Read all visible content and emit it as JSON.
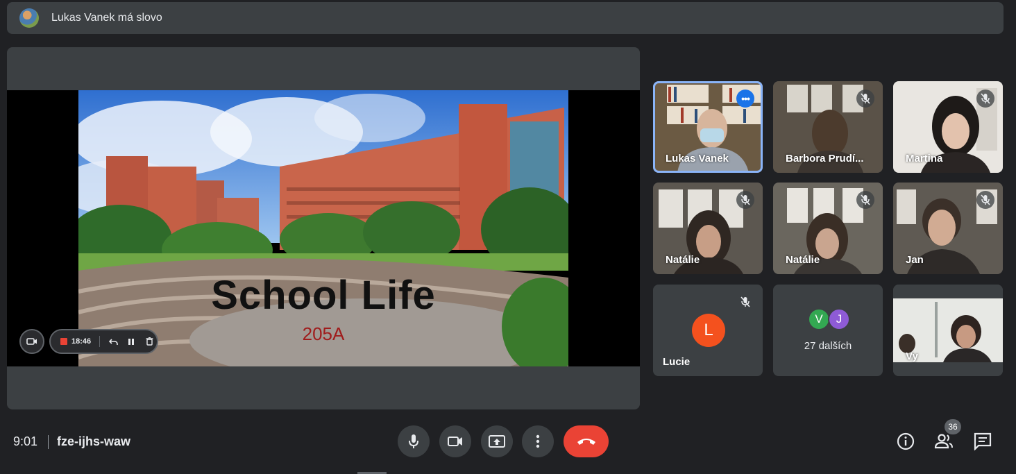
{
  "banner": {
    "text": "Lukas Vanek má slovo"
  },
  "presentation": {
    "slide_title": "School Life",
    "slide_subtitle": "205A",
    "recording_time": "18:46"
  },
  "participants": [
    {
      "name": "Lukas Vanek",
      "state": "speaking"
    },
    {
      "name": "Barbora Prudí...",
      "state": "muted"
    },
    {
      "name": "Martina",
      "state": "muted"
    },
    {
      "name": "Natálie",
      "state": "muted"
    },
    {
      "name": "Natálie",
      "state": "muted"
    },
    {
      "name": "Jan",
      "state": "muted"
    },
    {
      "name": "Lucie",
      "state": "muted",
      "initial": "L"
    },
    {
      "initials": [
        "V",
        "J"
      ],
      "label": "27 dalších"
    },
    {
      "name": "Vy"
    }
  ],
  "bottom_bar": {
    "time": "9:01",
    "meeting_code": "fze-ijhs-waw",
    "people_count": "36"
  },
  "colors": {
    "background": "#202124",
    "surface": "#3c4043",
    "leave_red": "#ea4335",
    "active_blue": "#8ab4f8",
    "avatar_orange": "#f4511e"
  },
  "icons": [
    "mic-icon",
    "camera-icon",
    "present-icon",
    "more-vert-icon",
    "hangup-icon",
    "info-icon",
    "people-icon",
    "chat-icon",
    "mic-off-icon",
    "undo-icon",
    "pause-icon",
    "delete-icon"
  ]
}
